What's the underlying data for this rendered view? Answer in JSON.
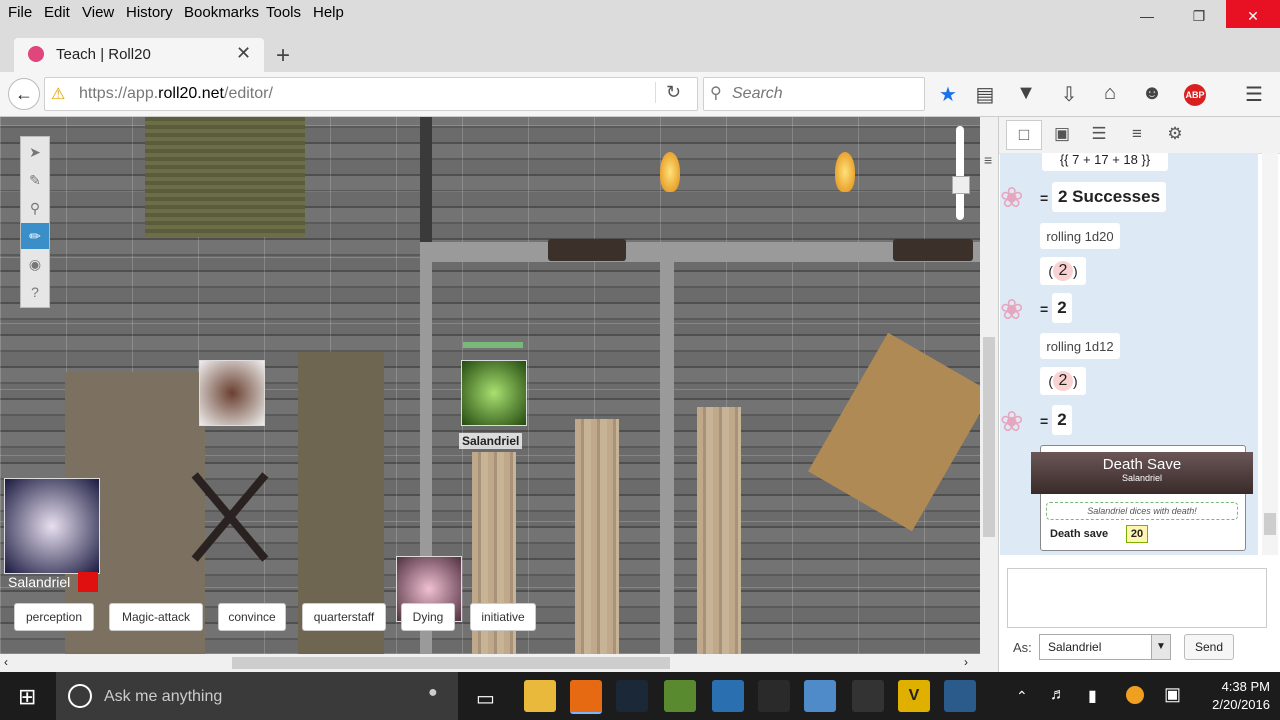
{
  "menubar": {
    "items": [
      "File",
      "Edit",
      "View",
      "History",
      "Bookmarks",
      "Tools",
      "Help"
    ]
  },
  "tab": {
    "title": "Teach | Roll20"
  },
  "navbar": {
    "url_prefix": "https://app.",
    "url_domain": "roll20.net",
    "url_suffix": "/editor/",
    "search_placeholder": "Search"
  },
  "map": {
    "token_name": "Salandriel",
    "selected_token_name": "Salandriel",
    "macros": [
      "perception",
      "Magic-attack",
      "convince",
      "quarterstaff",
      "Dying",
      "initiative"
    ]
  },
  "chat": {
    "partial_roll": "{{ 7 + 17 + 18 }}",
    "result1": "2 Successes",
    "roll2_label": "rolling 1d20",
    "roll2_die": "2",
    "result2": "2",
    "roll3_label": "rolling 1d12",
    "roll3_die": "2",
    "result3": "2",
    "equals": "=",
    "template": {
      "title": "Death Save",
      "subtitle": "Salandriel",
      "flavor": "Salandriel dices with death!",
      "row_label": "Death save",
      "row_value": "20"
    },
    "as_label": "As:",
    "as_value": "Salandriel",
    "send_label": "Send"
  },
  "taskbar": {
    "search_placeholder": "Ask me anything",
    "time": "4:38 PM",
    "date": "2/20/2016"
  },
  "colors": {
    "close_red": "#e81123",
    "chat_bg": "#dde9f4",
    "template_header": "#4a3a3a",
    "taskbar": "#1c1c1c"
  }
}
